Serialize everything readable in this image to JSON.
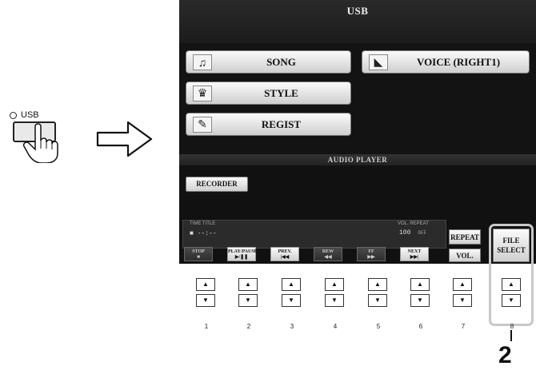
{
  "usb_panel": {
    "led_label": "USB"
  },
  "lcd": {
    "title": "USB",
    "tabs": [
      {
        "label": "SONG",
        "icon": "music-note-icon"
      },
      {
        "label": "STYLE",
        "icon": "drum-icon"
      },
      {
        "label": "REGIST",
        "icon": "document-icon"
      },
      {
        "label": "VOICE (RIGHT1)",
        "icon": "piano-icon"
      }
    ],
    "section_title": "AUDIO PLAYER",
    "recorder_label": "RECORDER",
    "player": {
      "labels": "TIME   TITLE",
      "time": "■  --:--",
      "vol_labels": "VOL. REPEAT",
      "vol_value": "100",
      "repeat_value": "OFF"
    },
    "transport": [
      {
        "top": "STOP",
        "bottom": "■"
      },
      {
        "top": "PLAY/PAUSE",
        "bottom": "▶/❚❚"
      },
      {
        "top": "PREV.",
        "bottom": "|◀◀"
      },
      {
        "top": "REW",
        "bottom": "◀◀"
      },
      {
        "top": "FF",
        "bottom": "▶▶"
      },
      {
        "top": "NEXT",
        "bottom": "▶▶|"
      }
    ],
    "repeat_label": "REPEAT",
    "vol_label": "VOL.",
    "file_select_line1": "FILE",
    "file_select_line2": "SELECT"
  },
  "buttons": {
    "up_symbol": "▲",
    "down_symbol": "▼",
    "numbers": [
      "1",
      "2",
      "3",
      "4",
      "5",
      "6",
      "7",
      "8"
    ]
  },
  "callout_number": "2"
}
